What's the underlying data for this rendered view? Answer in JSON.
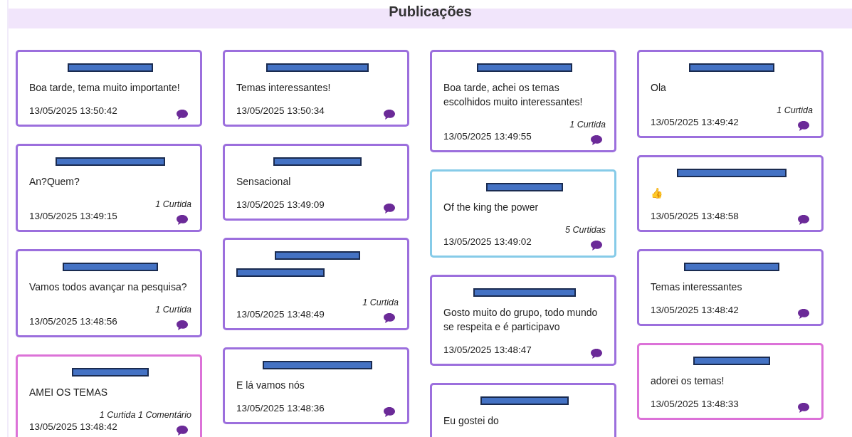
{
  "header": {
    "title": "Publicações"
  },
  "columns": [
    {
      "posts": [
        {
          "name_redacted": true,
          "message": "Boa tarde, tema muito importante!",
          "time": "13/05/2025 13:50:42",
          "color": "#9c6fdd"
        },
        {
          "name_redacted": true,
          "message": "An?Quem?",
          "stats": "1 Curtida",
          "time": "13/05/2025 13:49:15",
          "color": "#9c6fdd"
        },
        {
          "name_redacted": true,
          "message": "Vamos todos avançar na pesquisa?",
          "stats": "1 Curtida",
          "time": "13/05/2025 13:48:56",
          "color": "#9c6fdd"
        },
        {
          "name_redacted": true,
          "message": "AMEI OS TEMAS",
          "stats": "1 Curtida 1 Comentário",
          "time": "13/05/2025 13:48:42",
          "color": "#dc72d8"
        }
      ]
    },
    {
      "posts": [
        {
          "name_redacted": true,
          "message": "Temas interessantes!",
          "time": "13/05/2025 13:50:34",
          "color": "#9c6fdd"
        },
        {
          "name_redacted": true,
          "message": "Sensacional",
          "time": "13/05/2025 13:49:09",
          "color": "#9c6fdd"
        },
        {
          "name_redacted": true,
          "message_redacted": true,
          "stats": "1 Curtida",
          "time": "13/05/2025 13:48:49",
          "color": "#9c6fdd"
        },
        {
          "name_redacted": true,
          "message": "E lá vamos nós",
          "time": "13/05/2025 13:48:36",
          "color": "#9c6fdd"
        }
      ]
    },
    {
      "posts": [
        {
          "name_redacted": true,
          "message": "Boa tarde, achei os temas escolhidos muito interessantes!",
          "stats": "1 Curtida",
          "time": "13/05/2025 13:49:55",
          "color": "#9c6fdd"
        },
        {
          "name_redacted": true,
          "message": "Of the king the power",
          "stats": "5 Curtidas",
          "time": "13/05/2025 13:49:02",
          "color": "#86cbe8"
        },
        {
          "name_redacted": true,
          "message": "Gosto muito do grupo, todo mundo se respeita e é participavo",
          "time": "13/05/2025 13:48:47",
          "color": "#9c6fdd"
        },
        {
          "name_redacted": true,
          "message": "Eu gostei do",
          "color": "#9c6fdd"
        }
      ]
    },
    {
      "posts": [
        {
          "name_redacted": true,
          "message": "Ola",
          "stats": "1 Curtida",
          "time": "13/05/2025 13:49:42",
          "color": "#9c6fdd"
        },
        {
          "name_redacted": true,
          "message": "👍",
          "time": "13/05/2025 13:48:58",
          "color": "#9c6fdd"
        },
        {
          "name_redacted": true,
          "message": "Temas interessantes",
          "time": "13/05/2025 13:48:42",
          "color": "#9c6fdd"
        },
        {
          "name_redacted": true,
          "message": "adorei os temas!",
          "time": "13/05/2025 13:48:33",
          "color": "#dc72d8"
        }
      ]
    }
  ]
}
